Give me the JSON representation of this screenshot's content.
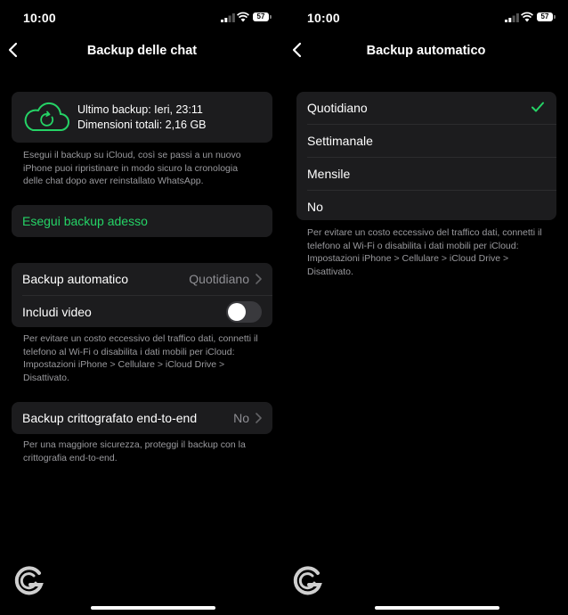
{
  "status_bar": {
    "time": "10:00",
    "battery": "57"
  },
  "left": {
    "title": "Backup delle chat",
    "backup_card": {
      "last_backup": "Ultimo backup: Ieri, 23:11",
      "total_size": "Dimensioni totali: 2,16 GB",
      "icon": "cloud-sync-icon"
    },
    "backup_note": "Esegui il backup su iCloud, così se passi a un nuovo iPhone puoi ripristinare in modo sicuro la cronologia delle chat dopo aver reinstallato WhatsApp.",
    "backup_now_label": "Esegui backup adesso",
    "auto_backup": {
      "label": "Backup automatico",
      "value": "Quotidiano"
    },
    "include_video": {
      "label": "Includi video",
      "enabled": false
    },
    "traffic_note": "Per evitare un costo eccessivo del traffico dati, connetti il telefono al Wi-Fi o disabilita i dati mobili per iCloud: Impostazioni iPhone > Cellulare > iCloud Drive > Disattivato.",
    "e2e": {
      "label": "Backup crittografato end-to-end",
      "value": "No"
    },
    "e2e_note": "Per una maggiore sicurezza, proteggi il backup con la crittografia end-to-end."
  },
  "right": {
    "title": "Backup automatico",
    "options": [
      "Quotidiano",
      "Settimanale",
      "Mensile",
      "No"
    ],
    "selected": "Quotidiano",
    "traffic_note": "Per evitare un costo eccessivo del traffico dati, connetti il telefono al Wi-Fi o disabilita i dati mobili per iCloud: Impostazioni iPhone > Cellulare > iCloud Drive > Disattivato."
  },
  "colors": {
    "accent_green": "#25d366",
    "card_bg": "#1c1c1e",
    "note_gray": "#9a9a9e"
  }
}
